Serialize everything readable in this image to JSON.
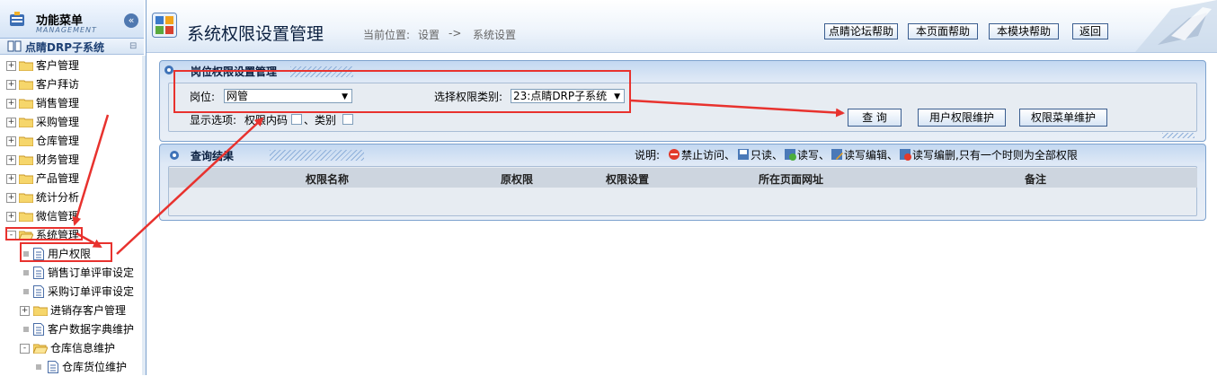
{
  "sidebar": {
    "menu_title": "功能菜单",
    "menu_subtitle": "MANAGEMENT",
    "collapse_icon": "«",
    "system_name": "点睛DRP子系统",
    "tree": [
      {
        "label": "客户管理",
        "type": "folder",
        "level": 0
      },
      {
        "label": "客户拜访",
        "type": "folder",
        "level": 0
      },
      {
        "label": "销售管理",
        "type": "folder",
        "level": 0
      },
      {
        "label": "采购管理",
        "type": "folder",
        "level": 0
      },
      {
        "label": "仓库管理",
        "type": "folder",
        "level": 0
      },
      {
        "label": "财务管理",
        "type": "folder",
        "level": 0
      },
      {
        "label": "产品管理",
        "type": "folder",
        "level": 0
      },
      {
        "label": "统计分析",
        "type": "folder",
        "level": 0
      },
      {
        "label": "微信管理",
        "type": "folder",
        "level": 0
      },
      {
        "label": "系统管理",
        "type": "folder-open",
        "level": 0
      },
      {
        "label": "用户权限",
        "type": "doc",
        "level": 1
      },
      {
        "label": "销售订单评审设定",
        "type": "doc",
        "level": 1
      },
      {
        "label": "采购订单评审设定",
        "type": "doc",
        "level": 1
      },
      {
        "label": "进销存客户管理",
        "type": "folder",
        "level": 1
      },
      {
        "label": "客户数据字典维护",
        "type": "doc",
        "level": 1
      },
      {
        "label": "仓库信息维护",
        "type": "folder-open",
        "level": 1
      },
      {
        "label": "仓库货位维护",
        "type": "doc",
        "level": 2
      }
    ]
  },
  "header": {
    "title": "系统权限设置管理",
    "crumb_prefix": "当前位置:",
    "crumb_1": "设置",
    "crumb_sep": "->",
    "crumb_2": "系统设置",
    "buttons": {
      "forum_help": "点睛论坛帮助",
      "page_help": "本页面帮助",
      "module_help": "本模块帮助",
      "back": "返回"
    }
  },
  "query_panel": {
    "title": "岗位权限设置管理",
    "position_label": "岗位:",
    "position_value": "网管",
    "category_label": "选择权限类别:",
    "category_value": "23:点睛DRP子系统",
    "display_label": "显示选项:",
    "option_code": "权限内码",
    "option_category": "、类别",
    "query_button": "查 询",
    "user_perm_button": "用户权限维护",
    "menu_perm_button": "权限菜单维护"
  },
  "result_panel": {
    "title": "查询结果",
    "legend_prefix": "说明:",
    "legend": [
      {
        "label": "禁止访问、",
        "icon": "no-access-icon"
      },
      {
        "label": "只读、",
        "icon": "read-only-icon"
      },
      {
        "label": "读写、",
        "icon": "read-write-icon"
      },
      {
        "label": "读写编辑、",
        "icon": "read-write-edit-icon"
      },
      {
        "label": "读写编删,只有一个时则为全部权限",
        "icon": "read-write-delete-icon"
      }
    ],
    "columns": [
      "权限名称",
      "原权限",
      "权限设置",
      "所在页面网址",
      "备注"
    ]
  },
  "colors": {
    "accent": "#7da2ce",
    "annotation": "#e8322e"
  }
}
